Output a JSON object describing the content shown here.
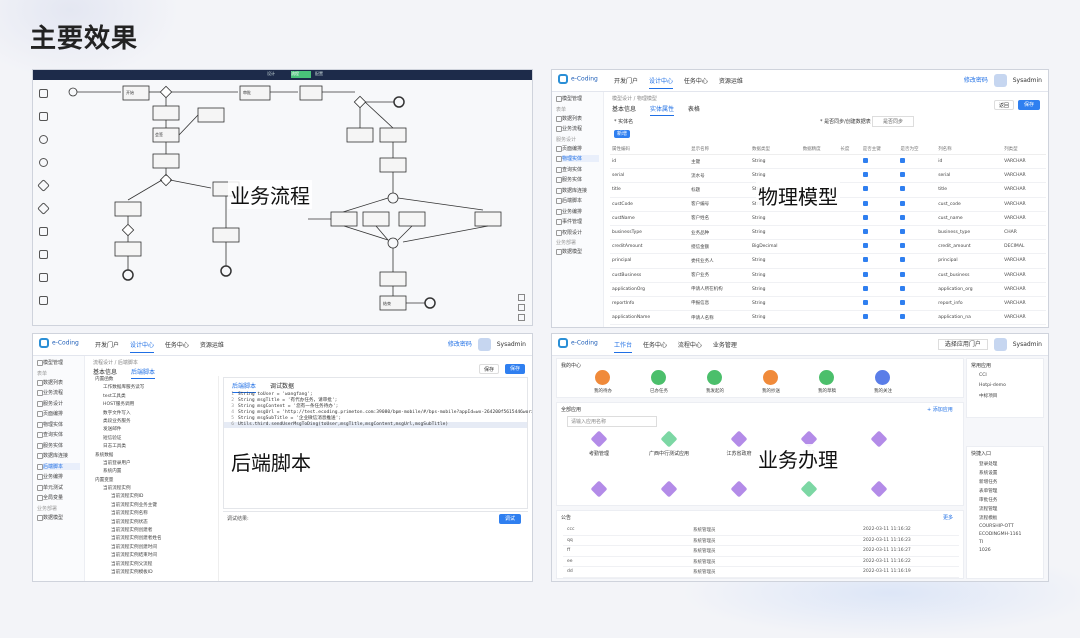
{
  "slide": {
    "title": "主要效果"
  },
  "panels": {
    "flow": {
      "label": "业务流程",
      "tabs": [
        "设计",
        "流程",
        "配置"
      ],
      "nodes": [
        "开始",
        "审批",
        "会签",
        "结束"
      ]
    },
    "model": {
      "label": "物理模型",
      "app": {
        "logo_line1": "primeton",
        "logo_line2": "e-Coding",
        "nav": [
          "开发门户",
          "设计中心",
          "任务中心",
          "资源运维"
        ],
        "active_nav": "设计中心",
        "user_link": "修改密码",
        "user_name": "Sysadmin"
      },
      "breadcrumb": "模型设计 / 物理模型",
      "tabs": [
        "基本信息",
        "实体属性",
        "表格"
      ],
      "buttons": {
        "back": "返回",
        "save": "保存",
        "add": "新增"
      },
      "form": {
        "name_label": "* 实体名",
        "status_label": "* 是否同步/创建数据表",
        "status_value": "是否同步"
      },
      "columns": [
        "属性编码",
        "",
        "显示名称",
        "数据类型",
        "数据精度",
        "长度",
        "是否主键",
        "是否为空",
        "列名称",
        "列类型"
      ],
      "rows": [
        [
          "id",
          "",
          "主键",
          "String",
          "",
          "",
          "",
          "",
          "id",
          "VARCHAR"
        ],
        [
          "serial",
          "",
          "流水号",
          "String",
          "",
          "",
          "",
          "",
          "serial",
          "VARCHAR"
        ],
        [
          "title",
          "",
          "标题",
          "String",
          "",
          "",
          "",
          "",
          "title",
          "VARCHAR"
        ],
        [
          "custCode",
          "",
          "客户编号",
          "String",
          "",
          "",
          "",
          "",
          "cust_code",
          "VARCHAR"
        ],
        [
          "custName",
          "",
          "客户姓名",
          "String",
          "",
          "",
          "",
          "",
          "cust_name",
          "VARCHAR"
        ],
        [
          "businessType",
          "",
          "业务品种",
          "String",
          "",
          "",
          "",
          "",
          "business_type",
          "CHAR"
        ],
        [
          "creditAmount",
          "",
          "授信金额",
          "BigDecimal",
          "",
          "",
          "",
          "",
          "credit_amount",
          "DECIMAL"
        ],
        [
          "principal",
          "",
          "委托业务人",
          "String",
          "",
          "",
          "",
          "",
          "principal",
          "VARCHAR"
        ],
        [
          "custBusiness",
          "",
          "客户业务",
          "String",
          "",
          "",
          "",
          "",
          "cust_business",
          "VARCHAR"
        ],
        [
          "applicationOrg",
          "",
          "申请人所在机构",
          "String",
          "",
          "",
          "",
          "",
          "application_org",
          "VARCHAR"
        ],
        [
          "reportInfo",
          "",
          "申报信息",
          "String",
          "",
          "",
          "",
          "",
          "report_info",
          "VARCHAR"
        ],
        [
          "applicationName",
          "",
          "申请人名称",
          "String",
          "",
          "",
          "",
          "",
          "application_na",
          "VARCHAR"
        ]
      ],
      "sidebar": [
        "模型管理",
        "表单",
        "数据列表",
        "业务流程",
        "服务设计",
        "页面编排",
        "物理实体",
        "查询实体",
        "服务实体",
        "数据库连接",
        "后端脚本",
        "业务编排",
        "事件管理",
        "权限设计",
        "业务部署",
        "数据模型"
      ]
    },
    "script": {
      "label": "后端脚本",
      "app": {
        "logo_line1": "primeton",
        "logo_line2": "e-Coding",
        "nav": [
          "开发门户",
          "设计中心",
          "任务中心",
          "资源运维"
        ],
        "active_nav": "设计中心",
        "user_link": "修改密码",
        "user_name": "Sysadmin"
      },
      "breadcrumb": "流程设计 / 后端脚本",
      "tabs": [
        "基本信息",
        "后端脚本"
      ],
      "buttons": {
        "save": "保存",
        "run": "调试",
        "version": "保存"
      },
      "editor_tabs": [
        "后端脚本",
        "调试数据"
      ],
      "code_lines": [
        "String toUser = 'wangfang';",
        "String msgTitle = '有代办任务，请审批';",
        "String msgContent = '您有一条任务待办';",
        "String msgUrl = 'http://test.ecoding.primeton.com:39080/bpm-mobile/#/bps-mobile?appId=wx-264200f5615446worx55';",
        "String msgSubTitle = '企业微信消息推送';",
        "Utils.third.sendUserMsgToDing(toUser,msgTitle,msgContent,msgUrl,msgSubTitle)"
      ],
      "console_label": "调试结果:",
      "tree": [
        "内置函数",
        "工作数据库服务读写",
        "test工具类",
        "HOST服务调用",
        "数字文件写入",
        "类段业务服务",
        "发送邮件",
        "短信验证",
        "日志工具类",
        "系统数据",
        "当前登录用户",
        "系统内置",
        "内置变量",
        "当前流程实例",
        "当前流程实例ID",
        "当前流程实例业务主键",
        "当前流程实例名称",
        "当前流程实例状态",
        "当前流程实例创建者",
        "当前流程实例创建者姓名",
        "当前流程实例创建时间",
        "当前流程实例结束时间",
        "当前流程实例父流程",
        "当前流程实例模板ID"
      ],
      "sidebar": [
        "模型管理",
        "表单",
        "数据列表",
        "业务流程",
        "服务设计",
        "页面编排",
        "物理实体",
        "查询实体",
        "服务实体",
        "数据库连接",
        "后端脚本",
        "业务编排",
        "单元测试",
        "全局变量",
        "业务部署",
        "数据模型"
      ]
    },
    "workbench": {
      "label": "业务办理",
      "app": {
        "logo_line1": "primeton",
        "logo_line2": "e-Coding",
        "nav": [
          "工作台",
          "任务中心",
          "流程中心",
          "业务管理"
        ],
        "active_nav": "工作台",
        "user_select": "选择应用门户",
        "user_name": "Sysadmin"
      },
      "quick_title": "我的中心",
      "quick": [
        "我的待办",
        "已办任务",
        "我发起的",
        "我的抄送",
        "我的草稿",
        "我的关注"
      ],
      "quick_colors": [
        "#f08a3a",
        "#4bbf6b",
        "#4bbf6b",
        "#f08a3a",
        "#4bbf6b",
        "#5a7de8"
      ],
      "apps_title": "全部应用",
      "apps_more": "+ 添加应用",
      "apps_search": "请输入应用名称",
      "apps": [
        "考勤管理",
        "广西中行测试应用",
        "江苏省政府",
        "bt12",
        "",
        "",
        "",
        "",
        "",
        ""
      ],
      "ann_title": "公告",
      "ann_more": "更多",
      "announcements": [
        [
          "ccc",
          "系统管理员",
          "2022-03-11 11:16:32"
        ],
        [
          "qq",
          "系统管理员",
          "2022-03-11 11:16:23"
        ],
        [
          "ff",
          "系统管理员",
          "2022-03-11 11:16:27"
        ],
        [
          "ee",
          "系统管理员",
          "2022-03-11 11:16:22"
        ],
        [
          "dd",
          "系统管理员",
          "2022-03-11 11:16:19"
        ]
      ],
      "side_title": "常用应用",
      "side_apps": [
        "CCI",
        "Hotpi-demo",
        "中标项目"
      ],
      "shortcut_title": "快捷入口",
      "shortcuts": [
        "登录处理",
        "系统设置",
        "新增任务",
        "表单管理",
        "审批任务",
        "流程管理",
        "流程模板",
        "COURSHIP-OTT",
        "ECODINGMH-1161",
        "TI",
        "1026"
      ]
    }
  }
}
